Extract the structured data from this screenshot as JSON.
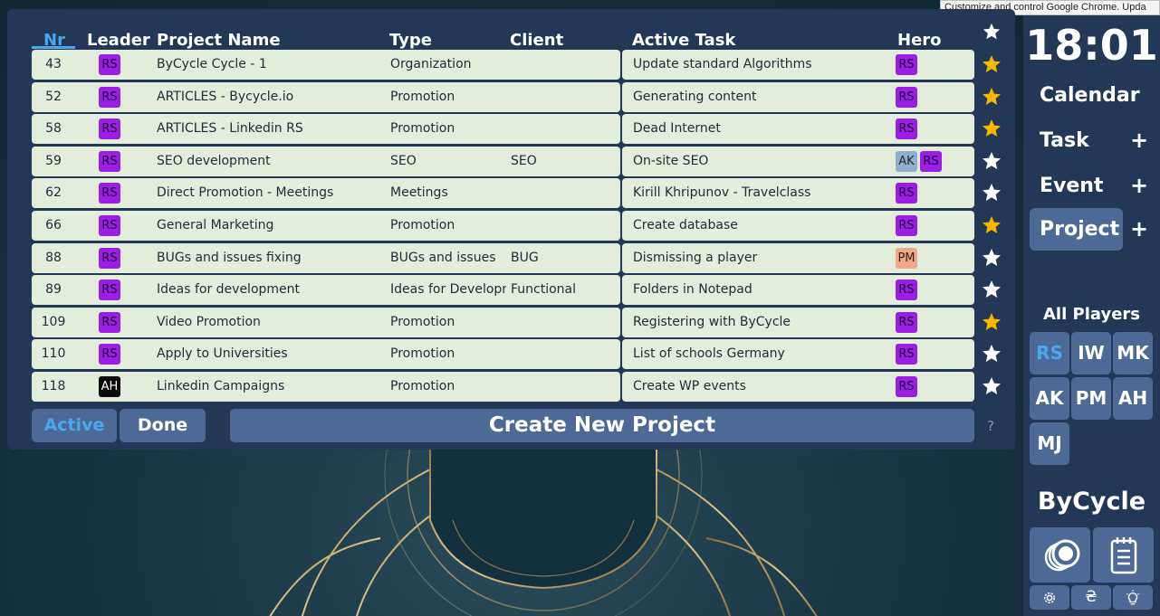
{
  "tooltip": "Customize and control Google Chrome. Upda",
  "table": {
    "headers": {
      "nr": "Nr",
      "leader": "Leader",
      "project_name": "Project Name",
      "type": "Type",
      "client": "Client",
      "active_task": "Active Task",
      "hero": "Hero"
    },
    "rows": [
      {
        "nr": "43",
        "leader": "RS",
        "name": "ByCycle Cycle - 1",
        "type": "Organization",
        "client": "",
        "task": "Update standard Algorithms",
        "heroes": [
          "RS"
        ],
        "starred": true
      },
      {
        "nr": "52",
        "leader": "RS",
        "name": "ARTICLES - Bycycle.io",
        "type": "Promotion",
        "client": "",
        "task": "Generating content",
        "heroes": [
          "RS"
        ],
        "starred": true
      },
      {
        "nr": "58",
        "leader": "RS",
        "name": "ARTICLES - Linkedin RS",
        "type": "Promotion",
        "client": "",
        "task": "Dead Internet",
        "heroes": [
          "RS"
        ],
        "starred": true
      },
      {
        "nr": "59",
        "leader": "RS",
        "name": "SEO development",
        "type": "SEO",
        "client": "SEO",
        "task": "On-site SEO",
        "heroes": [
          "AK",
          "RS"
        ],
        "starred": false
      },
      {
        "nr": "62",
        "leader": "RS",
        "name": "Direct Promotion - Meetings",
        "type": "Meetings",
        "client": "",
        "task": "Kirill Khripunov - Travelclass",
        "heroes": [
          "RS"
        ],
        "starred": false
      },
      {
        "nr": "66",
        "leader": "RS",
        "name": "General Marketing",
        "type": "Promotion",
        "client": "",
        "task": "Create database",
        "heroes": [
          "RS"
        ],
        "starred": true
      },
      {
        "nr": "88",
        "leader": "RS",
        "name": "BUGs and issues fixing",
        "type": "BUGs and issues",
        "client": "BUG",
        "task": "Dismissing a player",
        "heroes": [
          "PM"
        ],
        "starred": false
      },
      {
        "nr": "89",
        "leader": "RS",
        "name": "Ideas for development",
        "type": "Ideas for Developm",
        "client": "Functional",
        "task": "Folders in Notepad",
        "heroes": [
          "RS"
        ],
        "starred": false
      },
      {
        "nr": "109",
        "leader": "RS",
        "name": "Video Promotion",
        "type": "Promotion",
        "client": "",
        "task": "Registering with ByCycle",
        "heroes": [
          "RS"
        ],
        "starred": true
      },
      {
        "nr": "110",
        "leader": "RS",
        "name": "Apply to Universities",
        "type": "Promotion",
        "client": "",
        "task": "List of schools Germany",
        "heroes": [
          "RS"
        ],
        "starred": false
      },
      {
        "nr": "118",
        "leader": "AH",
        "name": "Linkedin Campaigns",
        "type": "Promotion",
        "client": "",
        "task": "Create WP events",
        "heroes": [
          "RS"
        ],
        "starred": false
      }
    ]
  },
  "filters": {
    "active": "Active",
    "done": "Done"
  },
  "create_button": "Create New Project",
  "help": "?",
  "sidebar": {
    "clock": "18:01",
    "nav": {
      "calendar": "Calendar",
      "task": "Task",
      "event": "Event",
      "project": "Project",
      "plus": "+"
    },
    "players_title": "All Players",
    "players": [
      "RS",
      "IW",
      "MK",
      "AK",
      "PM",
      "AH",
      "MJ"
    ],
    "brand": "ByCycle",
    "currency_symbol": "₴"
  },
  "colors": {
    "accent": "#4aa8f0",
    "panel": "#233757",
    "button": "#4d6a96",
    "row": "#e3eddc",
    "star_on": "#f5b800",
    "badge_rs": "#9b1de6",
    "badge_ah": "#0a0a0a",
    "badge_ak": "#8fb0cc",
    "badge_pm": "#f0a88a"
  }
}
